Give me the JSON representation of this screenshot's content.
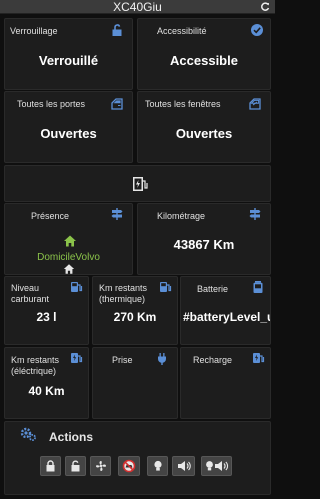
{
  "header": {
    "title": "XC40Giu",
    "refresh_icon": "refresh-icon"
  },
  "tiles": {
    "lock": {
      "label": "Verrouillage",
      "value": "Verrouillé",
      "icon": "unlock-icon"
    },
    "accessibility": {
      "label": "Accessibilité",
      "value": "Accessible",
      "icon": "check-circle-icon"
    },
    "doors": {
      "label": "Toutes les portes",
      "value": "Ouvertes",
      "icon": "car-door-icon"
    },
    "windows": {
      "label": "Toutes les fenêtres",
      "value": "Ouvertes",
      "icon": "car-window-icon"
    },
    "charging_station": {
      "icon": "ev-station-icon"
    },
    "presence": {
      "label": "Présence",
      "place": "DomicileVolvo",
      "icon": "signpost-icon",
      "home_icon": "home-icon"
    },
    "mileage": {
      "label": "Kilométrage",
      "value": "43867 Km",
      "icon": "signpost-icon"
    },
    "fuel": {
      "label_line1": "Niveau",
      "label_line2": "carburant",
      "value": "23 l",
      "icon": "gas-pump-icon"
    },
    "range_thermal": {
      "label_line1": "Km restants",
      "label_line2": "(thermique)",
      "value": "270 Km",
      "icon": "gas-pump-icon"
    },
    "battery": {
      "label": "Batterie",
      "value": "#batteryLevel_u",
      "icon": "battery-icon"
    },
    "range_electric": {
      "label_line1": "Km restants",
      "label_line2": "(éléctrique)",
      "value": "40 Km",
      "icon": "ev-station-icon"
    },
    "plug": {
      "label": "Prise",
      "icon": "plug-icon"
    },
    "recharge": {
      "label": "Recharge",
      "icon": "ev-station-icon"
    }
  },
  "actions": {
    "title": "Actions",
    "icon": "gears-icon",
    "buttons": [
      "lock-icon",
      "unlock-icon",
      "fan-icon",
      "no-car-icon",
      "light-icon",
      "horn-icon",
      "light-horn-icon"
    ]
  },
  "colors": {
    "accent_blue": "#5b8fd6",
    "presence_green": "#8bc34a",
    "tile_bg": "#1d1d1d"
  }
}
